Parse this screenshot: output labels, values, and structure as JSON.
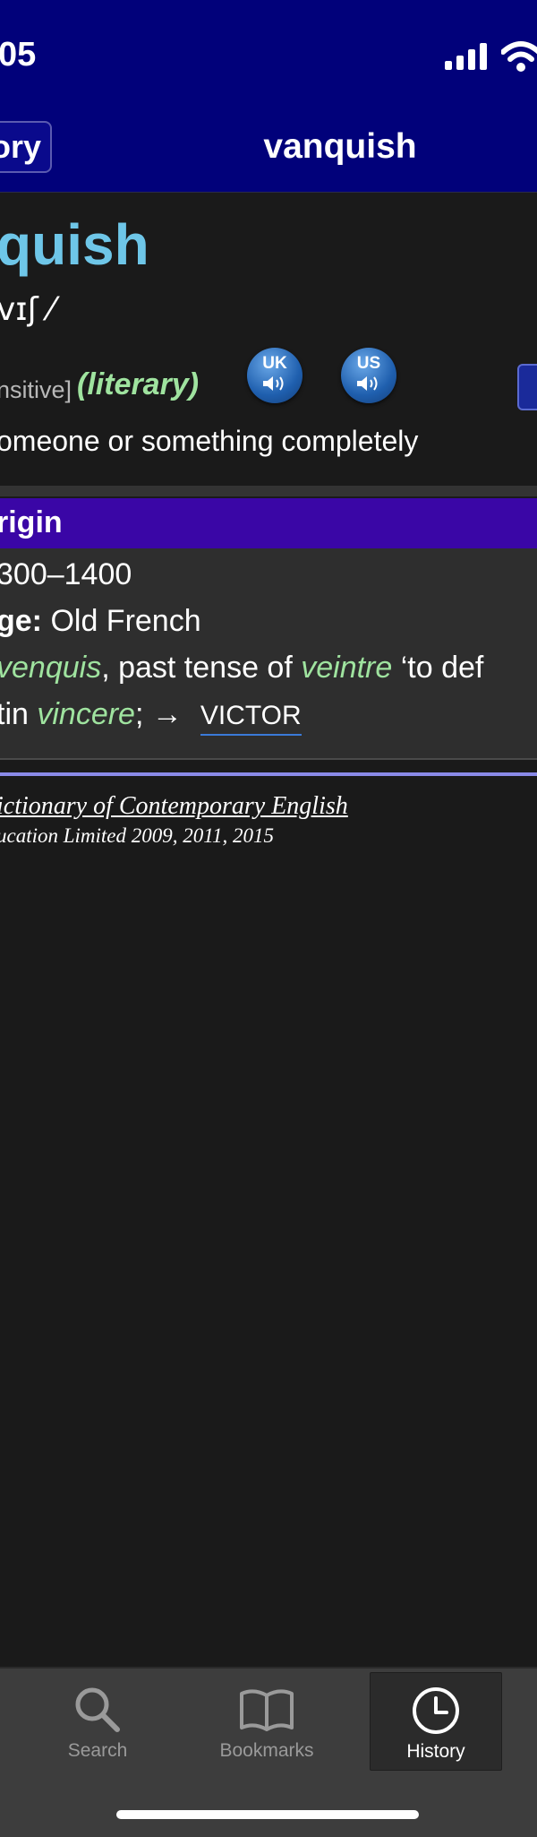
{
  "status": {
    "time": "05"
  },
  "nav": {
    "back_label": "ory",
    "title": "vanquish"
  },
  "entry": {
    "headword": "quish",
    "pronunciation": "vɪʃ ⁄",
    "grammar": "nsitive]",
    "register": "(literary)",
    "audio_uk": "UK",
    "audio_us": "US",
    "definition": "omeone or something completely"
  },
  "origin": {
    "title": "rigin",
    "date": "300–1400",
    "language_label": "ge:",
    "language_value": "Old French",
    "line3_word1": "venquis",
    "line3_text": ", past tense of ",
    "line3_word2": "veintre",
    "line3_text2": " ‘to def",
    "line4_prefix": "tin ",
    "line4_word": "vincere",
    "line4_suffix": "; →",
    "xref": "VICTOR"
  },
  "copyright": {
    "title": "ictionary of Contemporary English",
    "subtitle": "ucation Limited 2009, 2011, 2015"
  },
  "tabbar": {
    "search": "Search",
    "bookmarks": "Bookmarks",
    "history": "History"
  },
  "colors": {
    "nav_bg": "#01017a",
    "headword": "#6ec6e8",
    "register_green": "#9fe39f",
    "origin_header": "#3a06a6",
    "xref_underline": "#3a7ad8"
  }
}
